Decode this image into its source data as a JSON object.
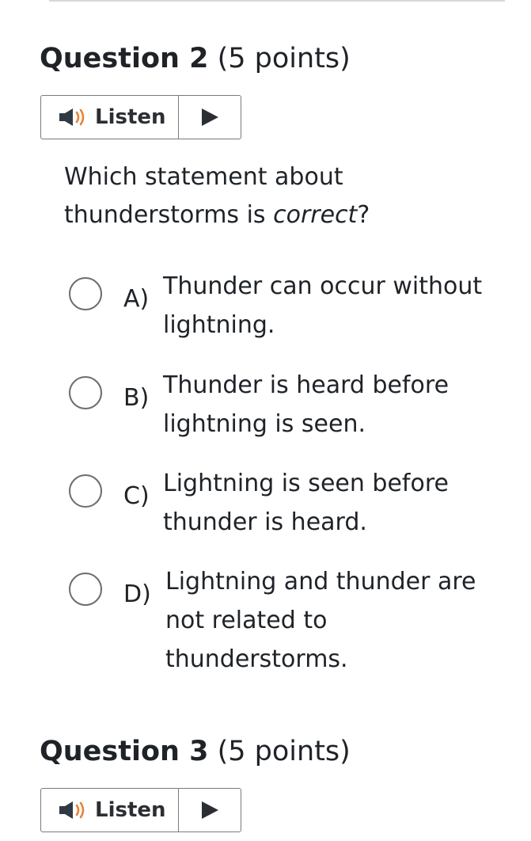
{
  "question2": {
    "number": "Question 2",
    "points": "(5 points)",
    "listen": {
      "label": "Listen",
      "speaker_icon": "speaker-icon",
      "play_icon": "play-icon",
      "speaker_color": "#2f3a44",
      "waves_color": "#e8843a"
    },
    "prompt_start": "Which statement about thunderstorms is ",
    "prompt_emphasis": "correct",
    "prompt_end": "?",
    "options": [
      {
        "letter": "A)",
        "text": "Thunder can occur without lightning."
      },
      {
        "letter": "B)",
        "text": "Thunder is heard before lightning is seen."
      },
      {
        "letter": "C)",
        "text": "Lightning is seen before thunder is heard."
      },
      {
        "letter": "D)",
        "text": "Lightning and thunder are not related to thunderstorms."
      }
    ]
  },
  "question3": {
    "number": "Question 3",
    "points": "(5 points)",
    "listen": {
      "label": "Listen"
    }
  }
}
